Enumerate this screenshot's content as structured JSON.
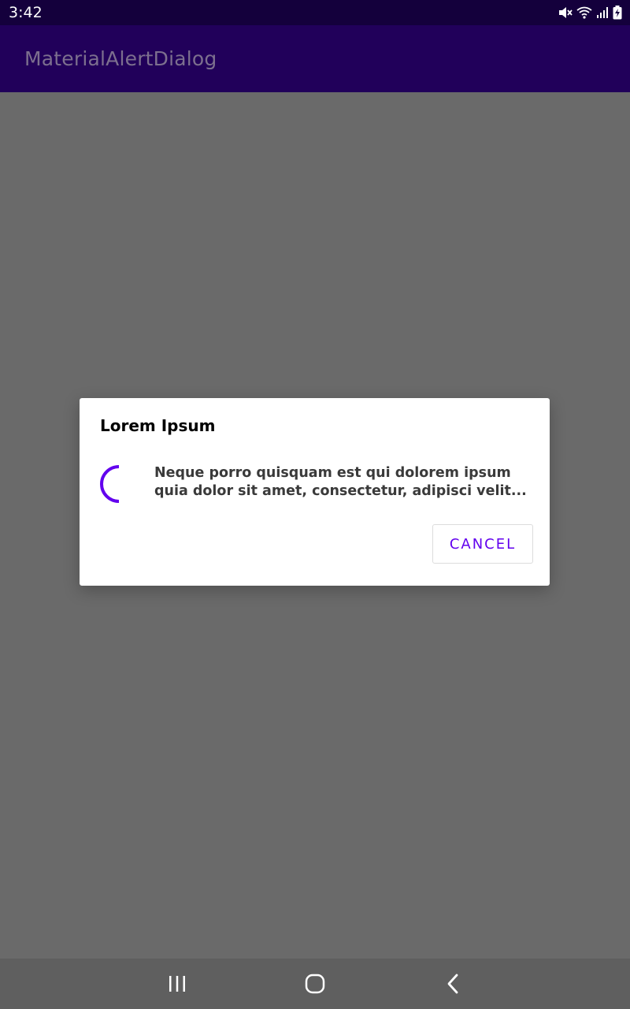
{
  "status_bar": {
    "time": "3:42",
    "icons": [
      "mute-icon",
      "wifi-icon",
      "signal-icon",
      "battery-charging-icon"
    ]
  },
  "app_bar": {
    "title": "MaterialAlertDialog"
  },
  "dialog": {
    "title": "Lorem Ipsum",
    "message": "Neque porro quisquam est qui dolorem ipsum quia dolor sit amet, consectetur, adipisci velit...",
    "cancel_label": "CANCEL",
    "accent_color": "#6200ee"
  },
  "nav_bar": {
    "buttons": [
      "recents-icon",
      "home-icon",
      "back-icon"
    ]
  },
  "colors": {
    "status_bar": "#14003c",
    "app_bar": "#21005a",
    "scrim": "#6a6a6a",
    "nav_bar": "#5f5f5f"
  }
}
